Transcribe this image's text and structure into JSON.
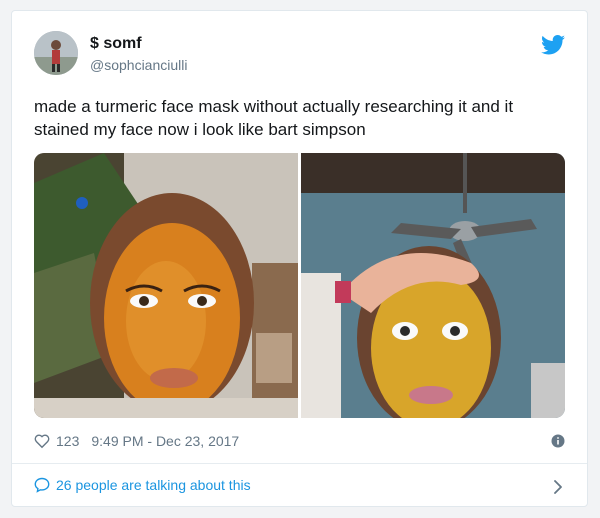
{
  "tweet": {
    "display_name": "$ somf",
    "handle": "@sophcianciulli",
    "text": "made a turmeric face mask without actually researching it and it stained my face now i look like bart simpson",
    "likes": "123",
    "timestamp": "9:49 PM - Dec 23, 2017",
    "conversation_link": "26 people are talking about this"
  },
  "icons": {
    "brand": "twitter-bird-icon",
    "like": "heart-icon",
    "info": "info-icon",
    "reply": "speech-bubble-icon",
    "more": "chevron-right-icon"
  },
  "colors": {
    "accent": "#1da1f2",
    "link": "#1b95e0",
    "muted": "#657786"
  }
}
